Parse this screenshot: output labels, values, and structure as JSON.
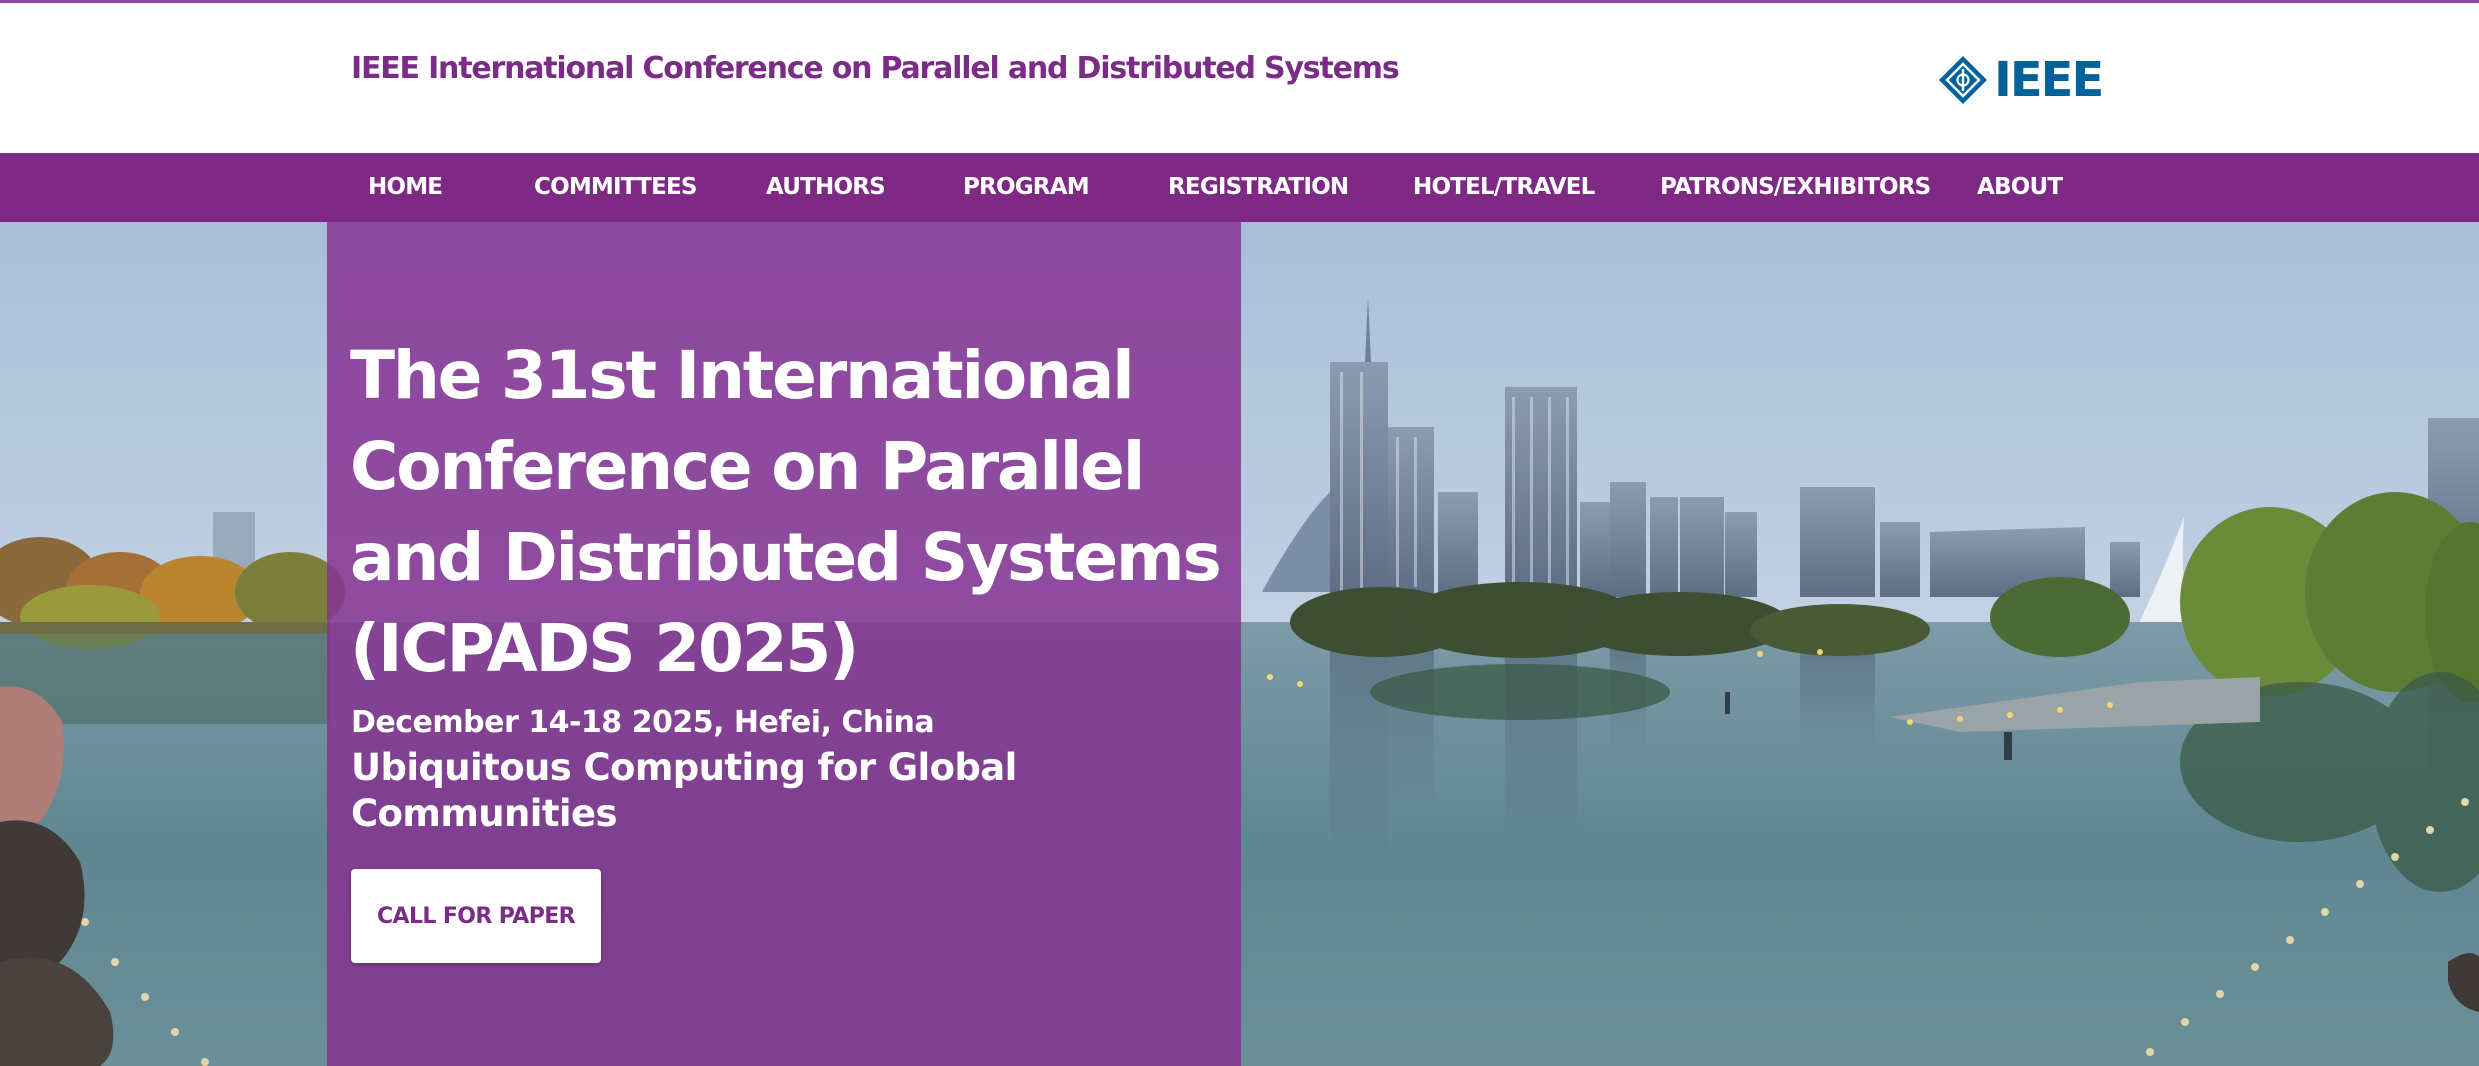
{
  "header": {
    "site_title": "IEEE International Conference on Parallel and Distributed Systems",
    "logo_text": "IEEE",
    "logo_icon": "ieee-diamond-icon"
  },
  "nav": {
    "items": [
      {
        "label": "HOME"
      },
      {
        "label": "COMMITTEES"
      },
      {
        "label": "AUTHORS"
      },
      {
        "label": "PROGRAM"
      },
      {
        "label": "REGISTRATION"
      },
      {
        "label": "HOTEL/TRAVEL"
      },
      {
        "label": "PATRONS/EXHIBITORS"
      },
      {
        "label": "ABOUT"
      }
    ]
  },
  "hero": {
    "title": "The 31st International Conference on Parallel and Distributed Systems (ICPADS 2025)",
    "dates": "December 14-18 2025, Hefei, China",
    "theme": "Ubiquitous Computing for Global Communities",
    "cta_label": "CALL FOR PAPER",
    "background": "city-skyline-lake-photo"
  },
  "colors": {
    "brand_purple": "#7e2a84",
    "panel_purple": "#853291",
    "title_purple": "#7a2c86",
    "ieee_blue": "#00629b"
  }
}
